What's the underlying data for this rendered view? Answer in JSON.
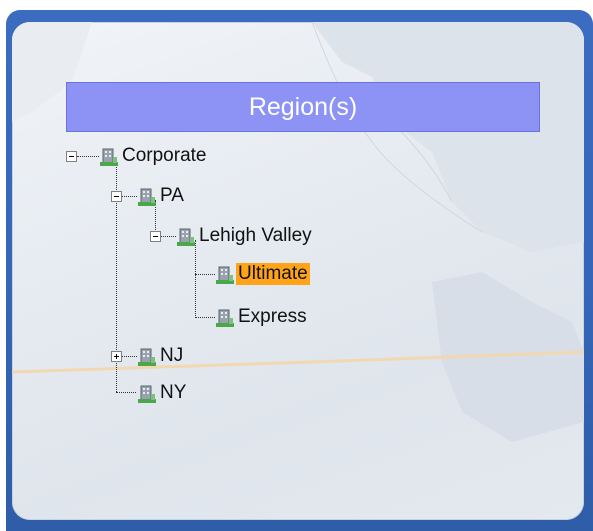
{
  "header": {
    "title": "Region(s)"
  },
  "tree": {
    "corporate": "Corporate",
    "pa": "PA",
    "lehigh_valley": "Lehigh Valley",
    "ultimate": "Ultimate",
    "express": "Express",
    "nj": "NJ",
    "ny": "NY"
  },
  "colors": {
    "frame": "#3566b8",
    "header_bg": "#8c93f4",
    "selection": "#ffa418"
  },
  "icons": {
    "node_icon": "building-icon",
    "expanded": "minus-box-icon",
    "collapsed": "plus-box-icon"
  }
}
